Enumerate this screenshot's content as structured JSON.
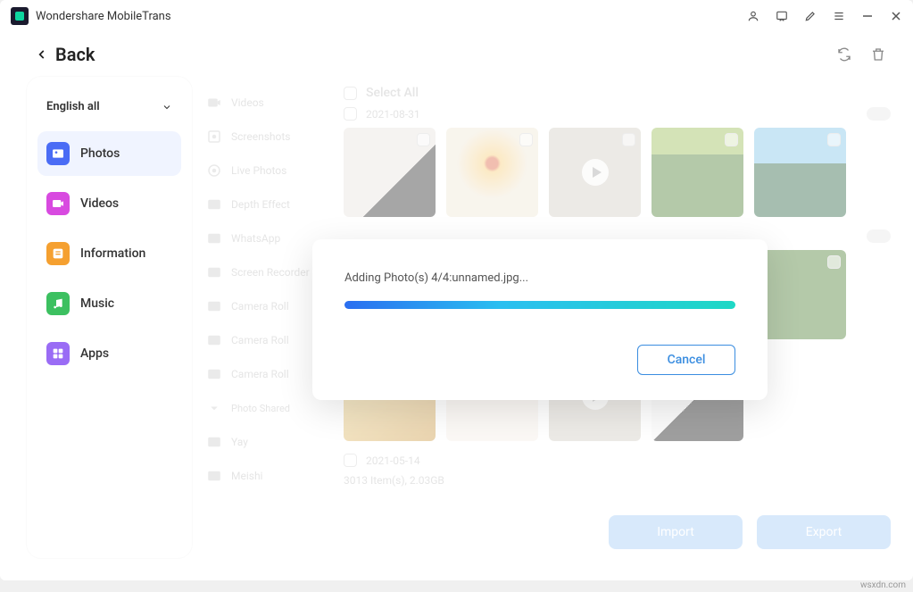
{
  "app": {
    "title": "Wondershare MobileTrans"
  },
  "back": {
    "label": "Back"
  },
  "sidebar": {
    "dropdown": "English all",
    "items": [
      {
        "label": "Photos",
        "color": "#4a6cf5"
      },
      {
        "label": "Videos",
        "color": "#d84ae0"
      },
      {
        "label": "Information",
        "color": "#f5a030"
      },
      {
        "label": "Music",
        "color": "#3cc060"
      },
      {
        "label": "Apps",
        "color": "#9a6cf5"
      }
    ]
  },
  "albums": {
    "items": [
      "Videos",
      "Screenshots",
      "Live Photos",
      "Depth Effect",
      "WhatsApp",
      "Screen Recorder",
      "Camera Roll",
      "Camera Roll",
      "Camera Roll"
    ],
    "sharedHeader": "Photo Shared",
    "shared": [
      "Yay",
      "Meishi"
    ]
  },
  "content": {
    "selectAll": "Select All",
    "date1": "2021-08-31",
    "date1count": "",
    "date2": "2021-05-14",
    "status": "3013 Item(s), 2.03GB",
    "importLabel": "Import",
    "exportLabel": "Export"
  },
  "modal": {
    "message": "Adding Photo(s) 4/4:unnamed.jpg...",
    "cancel": "Cancel"
  },
  "watermark": "wsxdn.com"
}
